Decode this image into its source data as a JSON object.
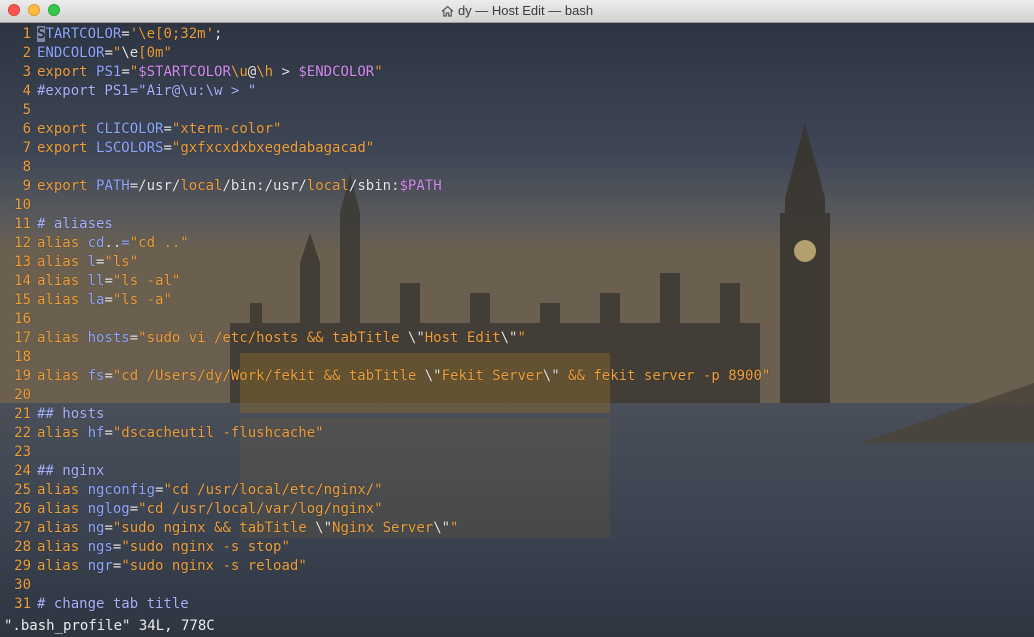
{
  "window": {
    "title": "dy — Host Edit — bash"
  },
  "editor": {
    "lines": [
      {
        "n": "1",
        "tokens": [
          {
            "t": "S",
            "c": "var cursor"
          },
          {
            "t": "TARTCOLOR",
            "c": "var"
          },
          {
            "t": "=",
            "c": "op"
          },
          {
            "t": "'\\e[0;32m'",
            "c": "str"
          },
          {
            "t": ";",
            "c": "op"
          }
        ]
      },
      {
        "n": "2",
        "tokens": [
          {
            "t": "ENDCOLOR",
            "c": "var"
          },
          {
            "t": "=",
            "c": "op"
          },
          {
            "t": "\"",
            "c": "str"
          },
          {
            "t": "\\e",
            "c": "esc"
          },
          {
            "t": "[0m\"",
            "c": "str"
          }
        ]
      },
      {
        "n": "3",
        "tokens": [
          {
            "t": "export ",
            "c": "key"
          },
          {
            "t": "PS1",
            "c": "var"
          },
          {
            "t": "=",
            "c": "op"
          },
          {
            "t": "\"",
            "c": "str"
          },
          {
            "t": "$STARTCOLOR",
            "c": "env"
          },
          {
            "t": "\\u",
            "c": "str"
          },
          {
            "t": "@",
            "c": "op"
          },
          {
            "t": "\\h",
            "c": "str"
          },
          {
            "t": " > ",
            "c": "op"
          },
          {
            "t": "$ENDCOLOR",
            "c": "env"
          },
          {
            "t": "\"",
            "c": "str"
          }
        ]
      },
      {
        "n": "4",
        "tokens": [
          {
            "t": "#export PS1=\"Air@\\u:\\w > \"",
            "c": "com"
          }
        ]
      },
      {
        "n": "5",
        "tokens": []
      },
      {
        "n": "6",
        "tokens": [
          {
            "t": "export ",
            "c": "key"
          },
          {
            "t": "CLICOLOR",
            "c": "var"
          },
          {
            "t": "=",
            "c": "op"
          },
          {
            "t": "\"xterm-color\"",
            "c": "str"
          }
        ]
      },
      {
        "n": "7",
        "tokens": [
          {
            "t": "export ",
            "c": "key"
          },
          {
            "t": "LSCOLORS",
            "c": "var"
          },
          {
            "t": "=",
            "c": "op"
          },
          {
            "t": "\"gxfxcxdxbxegedabagacad\"",
            "c": "str"
          }
        ]
      },
      {
        "n": "8",
        "tokens": []
      },
      {
        "n": "9",
        "tokens": [
          {
            "t": "export ",
            "c": "key"
          },
          {
            "t": "PATH",
            "c": "var"
          },
          {
            "t": "=/usr/",
            "c": "op"
          },
          {
            "t": "local",
            "c": "dir"
          },
          {
            "t": "/bin:/usr/",
            "c": "op"
          },
          {
            "t": "local",
            "c": "dir"
          },
          {
            "t": "/sbin:",
            "c": "op"
          },
          {
            "t": "$PATH",
            "c": "env"
          }
        ]
      },
      {
        "n": "10",
        "tokens": []
      },
      {
        "n": "11",
        "tokens": [
          {
            "t": "# aliases",
            "c": "com"
          }
        ]
      },
      {
        "n": "12",
        "tokens": [
          {
            "t": "alias ",
            "c": "key"
          },
          {
            "t": "cd",
            "c": "var"
          },
          {
            "t": "..",
            "c": "op"
          },
          {
            "t": "=",
            "c": "var"
          },
          {
            "t": "\"cd ..\"",
            "c": "str"
          }
        ]
      },
      {
        "n": "13",
        "tokens": [
          {
            "t": "alias ",
            "c": "key"
          },
          {
            "t": "l",
            "c": "var"
          },
          {
            "t": "=",
            "c": "op"
          },
          {
            "t": "\"ls\"",
            "c": "str"
          }
        ]
      },
      {
        "n": "14",
        "tokens": [
          {
            "t": "alias ",
            "c": "key"
          },
          {
            "t": "ll",
            "c": "var"
          },
          {
            "t": "=",
            "c": "op"
          },
          {
            "t": "\"ls -al\"",
            "c": "str"
          }
        ]
      },
      {
        "n": "15",
        "tokens": [
          {
            "t": "alias ",
            "c": "key"
          },
          {
            "t": "la",
            "c": "var"
          },
          {
            "t": "=",
            "c": "op"
          },
          {
            "t": "\"ls -a\"",
            "c": "str"
          }
        ]
      },
      {
        "n": "16",
        "tokens": []
      },
      {
        "n": "17",
        "tokens": [
          {
            "t": "alias ",
            "c": "key"
          },
          {
            "t": "hosts",
            "c": "var"
          },
          {
            "t": "=",
            "c": "op"
          },
          {
            "t": "\"sudo vi /etc/hosts && tabTitle ",
            "c": "str"
          },
          {
            "t": "\\\"",
            "c": "esc"
          },
          {
            "t": "Host Edit",
            "c": "str"
          },
          {
            "t": "\\\"",
            "c": "esc"
          },
          {
            "t": "\"",
            "c": "str"
          }
        ]
      },
      {
        "n": "18",
        "tokens": []
      },
      {
        "n": "19",
        "tokens": [
          {
            "t": "alias ",
            "c": "key"
          },
          {
            "t": "fs",
            "c": "var"
          },
          {
            "t": "=",
            "c": "op"
          },
          {
            "t": "\"cd /Users/dy/Work/fekit && tabTitle ",
            "c": "str"
          },
          {
            "t": "\\\"",
            "c": "esc"
          },
          {
            "t": "Fekit Server",
            "c": "str"
          },
          {
            "t": "\\\"",
            "c": "esc"
          },
          {
            "t": " && fekit server -p 8900\"",
            "c": "str"
          }
        ]
      },
      {
        "n": "20",
        "tokens": []
      },
      {
        "n": "21",
        "tokens": [
          {
            "t": "## hosts",
            "c": "com"
          }
        ]
      },
      {
        "n": "22",
        "tokens": [
          {
            "t": "alias ",
            "c": "key"
          },
          {
            "t": "hf",
            "c": "var"
          },
          {
            "t": "=",
            "c": "op"
          },
          {
            "t": "\"dscacheutil -flushcache\"",
            "c": "str"
          }
        ]
      },
      {
        "n": "23",
        "tokens": []
      },
      {
        "n": "24",
        "tokens": [
          {
            "t": "## nginx",
            "c": "com"
          }
        ]
      },
      {
        "n": "25",
        "tokens": [
          {
            "t": "alias ",
            "c": "key"
          },
          {
            "t": "ngconfig",
            "c": "var"
          },
          {
            "t": "=",
            "c": "op"
          },
          {
            "t": "\"cd /usr/local/etc/nginx/\"",
            "c": "str"
          }
        ]
      },
      {
        "n": "26",
        "tokens": [
          {
            "t": "alias ",
            "c": "key"
          },
          {
            "t": "nglog",
            "c": "var"
          },
          {
            "t": "=",
            "c": "op"
          },
          {
            "t": "\"cd /usr/local/var/log/nginx\"",
            "c": "str"
          }
        ]
      },
      {
        "n": "27",
        "tokens": [
          {
            "t": "alias ",
            "c": "key"
          },
          {
            "t": "ng",
            "c": "var"
          },
          {
            "t": "=",
            "c": "op"
          },
          {
            "t": "\"sudo nginx && tabTitle ",
            "c": "str"
          },
          {
            "t": "\\\"",
            "c": "esc"
          },
          {
            "t": "Nginx Server",
            "c": "str"
          },
          {
            "t": "\\\"",
            "c": "esc"
          },
          {
            "t": "\"",
            "c": "str"
          }
        ]
      },
      {
        "n": "28",
        "tokens": [
          {
            "t": "alias ",
            "c": "key"
          },
          {
            "t": "ngs",
            "c": "var"
          },
          {
            "t": "=",
            "c": "op"
          },
          {
            "t": "\"sudo nginx -s stop\"",
            "c": "str"
          }
        ]
      },
      {
        "n": "29",
        "tokens": [
          {
            "t": "alias ",
            "c": "key"
          },
          {
            "t": "ngr",
            "c": "var"
          },
          {
            "t": "=",
            "c": "op"
          },
          {
            "t": "\"sudo nginx -s reload\"",
            "c": "str"
          }
        ]
      },
      {
        "n": "30",
        "tokens": []
      },
      {
        "n": "31",
        "tokens": [
          {
            "t": "# change tab title",
            "c": "com"
          }
        ]
      }
    ],
    "status": "\".bash_profile\" 34L, 778C"
  }
}
